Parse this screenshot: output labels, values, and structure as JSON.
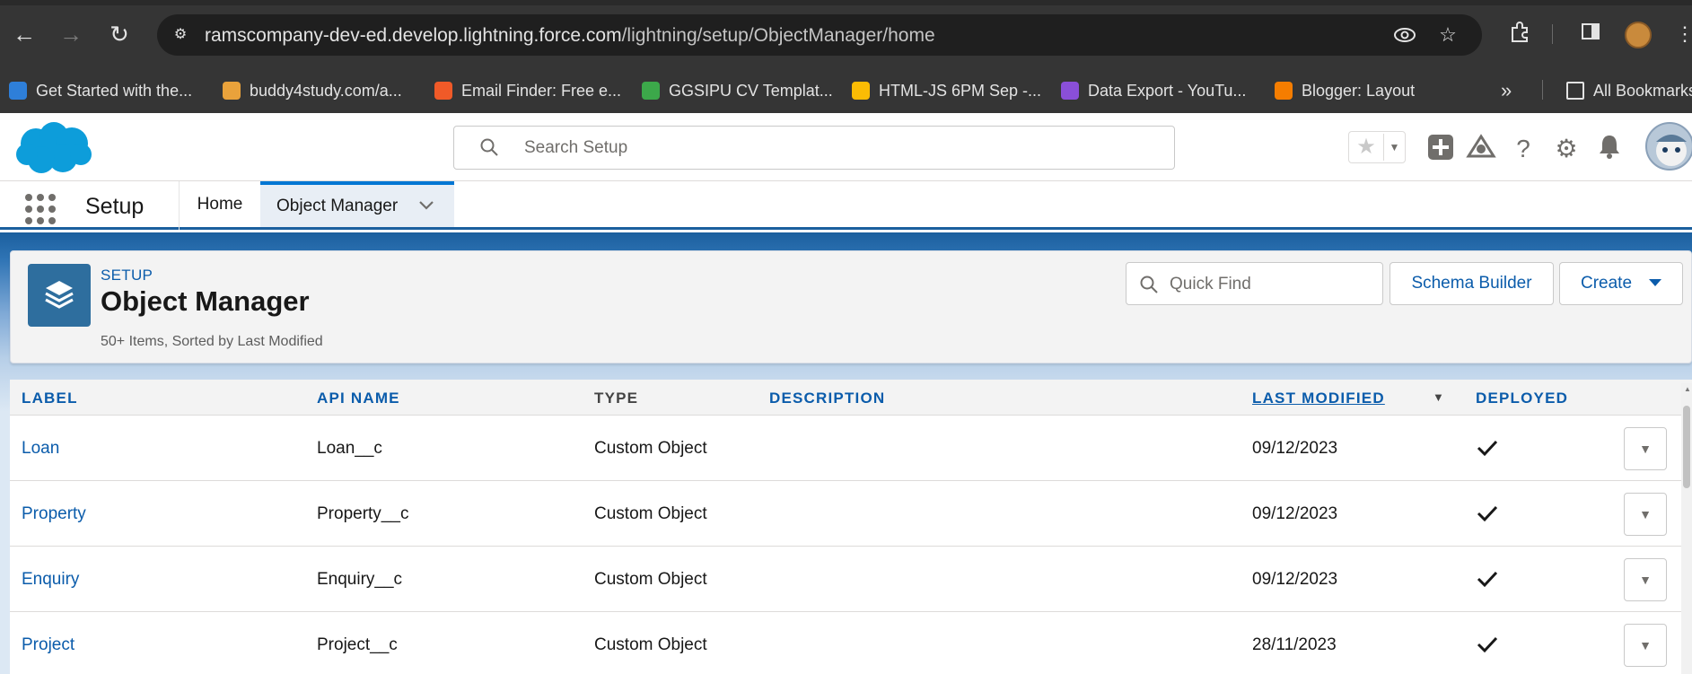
{
  "browser": {
    "url_host": "ramscompany-dev-ed.develop.lightning.force.com",
    "url_path": "/lightning/setup/ObjectManager/home",
    "bookmarks": [
      {
        "label": "Get Started with the...",
        "color": "#2e7fd9"
      },
      {
        "label": "buddy4study.com/a...",
        "color": "#e9a23b"
      },
      {
        "label": "Email Finder: Free e...",
        "color": "#f05a28"
      },
      {
        "label": "GGSIPU CV Templat...",
        "color": "#3ca84a"
      },
      {
        "label": "HTML-JS 6PM Sep -...",
        "color": "#fbbc04"
      },
      {
        "label": "Data Export - YouTu...",
        "color": "#8a4fd8"
      },
      {
        "label": "Blogger: Layout",
        "color": "#f57d00"
      }
    ],
    "overflow_label": "»",
    "all_bookmarks": "All Bookmarks"
  },
  "header": {
    "search_placeholder": "Search Setup"
  },
  "nav": {
    "app_name": "Setup",
    "items": [
      {
        "label": "Home"
      },
      {
        "label": "Object Manager"
      }
    ]
  },
  "page": {
    "eyebrow": "SETUP",
    "title": "Object Manager",
    "meta": "50+ Items, Sorted by Last Modified",
    "quick_find_placeholder": "Quick Find",
    "schema_builder_label": "Schema Builder",
    "create_label": "Create",
    "accent_color": "#0b5cab"
  },
  "table": {
    "columns": [
      "LABEL",
      "API NAME",
      "TYPE",
      "DESCRIPTION",
      "LAST MODIFIED",
      "DEPLOYED"
    ],
    "rows": [
      {
        "label": "Loan",
        "api_name": "Loan__c",
        "type": "Custom Object",
        "description": "",
        "last_modified": "09/12/2023",
        "deployed": true
      },
      {
        "label": "Property",
        "api_name": "Property__c",
        "type": "Custom Object",
        "description": "",
        "last_modified": "09/12/2023",
        "deployed": true
      },
      {
        "label": "Enquiry",
        "api_name": "Enquiry__c",
        "type": "Custom Object",
        "description": "",
        "last_modified": "09/12/2023",
        "deployed": true
      },
      {
        "label": "Project",
        "api_name": "Project__c",
        "type": "Custom Object",
        "description": "",
        "last_modified": "28/11/2023",
        "deployed": true
      }
    ]
  }
}
